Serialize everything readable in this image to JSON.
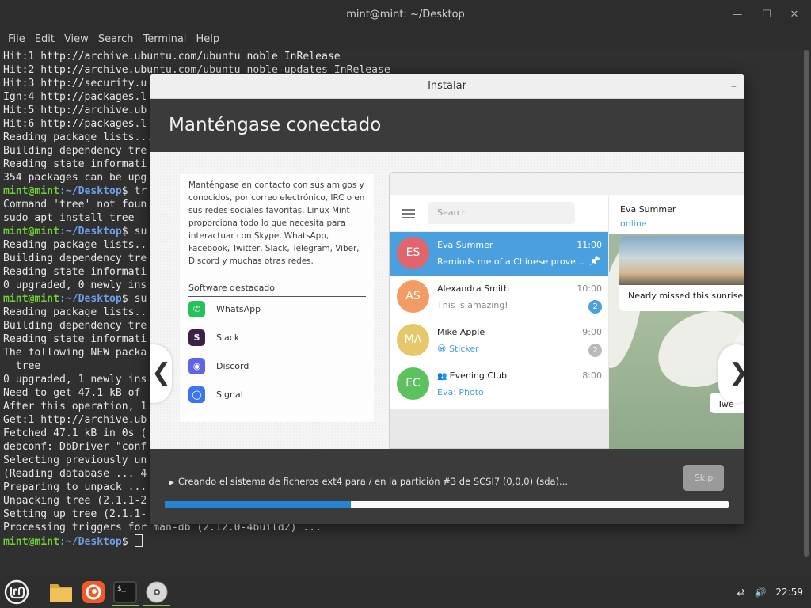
{
  "terminal": {
    "title": "mint@mint: ~/Desktop",
    "menu": [
      "File",
      "Edit",
      "View",
      "Search",
      "Terminal",
      "Help"
    ],
    "lines": [
      {
        "text": "Hit:1 http://archive.ubuntu.com/ubuntu noble InRelease"
      },
      {
        "text": "Hit:2 http://archive.ubuntu.com/ubuntu noble-updates InRelease"
      },
      {
        "text": "Hit:3 http://security.u"
      },
      {
        "text": "Ign:4 http://packages.l"
      },
      {
        "text": "Hit:5 http://archive.ub"
      },
      {
        "text": "Hit:6 http://packages.l"
      },
      {
        "text": "Reading package lists..."
      },
      {
        "text": "Building dependency tre"
      },
      {
        "text": "Reading state informati"
      },
      {
        "text": "354 packages can be upg"
      },
      {
        "prompt": true,
        "text": " tr"
      },
      {
        "text": "Command 'tree' not foun"
      },
      {
        "text": "sudo apt install tree"
      },
      {
        "prompt": true,
        "text": " su"
      },
      {
        "text": "Reading package lists.."
      },
      {
        "text": "Building dependency tre"
      },
      {
        "text": "Reading state informati"
      },
      {
        "text": "0 upgraded, 0 newly ins"
      },
      {
        "prompt": true,
        "text": " su"
      },
      {
        "text": "Reading package lists.."
      },
      {
        "text": "Building dependency tre"
      },
      {
        "text": "Reading state informati"
      },
      {
        "text": "The following NEW packa"
      },
      {
        "text": "  tree"
      },
      {
        "text": "0 upgraded, 1 newly ins"
      },
      {
        "text": "Need to get 47.1 kB of "
      },
      {
        "text": "After this operation, 1"
      },
      {
        "text": "Get:1 http://archive.ub"
      },
      {
        "text": "Fetched 47.1 kB in 0s ("
      },
      {
        "text": "debconf: DbDriver \"conf                                                             oble"
      },
      {
        "text": "Selecting previously un"
      },
      {
        "text": "(Reading database ... 4"
      },
      {
        "text": "Preparing to unpack ..."
      },
      {
        "text": "Unpacking tree (2.1.1-2"
      },
      {
        "text": "Setting up tree (2.1.1-"
      },
      {
        "text": "Processing triggers for man-db (2.12.0-4build2) ..."
      },
      {
        "prompt": true,
        "text": " ",
        "cursor": true
      }
    ],
    "prompt_user": "mint@mint",
    "prompt_path": ":~/Desktop",
    "prompt_sign": "$"
  },
  "installer": {
    "title": "Instalar",
    "minimize": "–",
    "header": "Manténgase conectado",
    "description": "Manténgase en contacto con sus amigos y conocidos, por correo electrónico, IRC o en sus redes sociales favoritas. Linux Mint proporciona todo lo que necesita para interactuar con Skype, WhatsApp, Facebook, Twitter, Slack, Telegram, Viber, Discord y muchas otras redes.",
    "featured_title": "Software destacado",
    "software": [
      {
        "name": "WhatsApp",
        "color": "#25c15a",
        "icon": "whatsapp-icon"
      },
      {
        "name": "Slack",
        "color": "#3e1f48",
        "icon": "slack-icon"
      },
      {
        "name": "Discord",
        "color": "#5b67e8",
        "icon": "discord-icon"
      },
      {
        "name": "Signal",
        "color": "#3a76f0",
        "icon": "signal-icon"
      }
    ],
    "prev": "❮",
    "next": "❯",
    "status": "Creando el sistema de ficheros ext4 para / en la partición #3 de SCSI7 (0,0,0) (sda)...",
    "skip": "Skip",
    "progress": 0.33,
    "accent": "#2585d4"
  },
  "telegram": {
    "search_placeholder": "Search",
    "chats": [
      {
        "initials": "ES",
        "name": "Eva Summer",
        "time": "11:00",
        "msg": "Reminds me of a Chinese proverb...",
        "color": "#e1656c",
        "selected": true,
        "pinned": true
      },
      {
        "initials": "AS",
        "name": "Alexandra Smith",
        "time": "10:00",
        "msg": "This is amazing!",
        "color": "#f29b64",
        "badge": "2",
        "badge_color": "#4a9fde"
      },
      {
        "initials": "MA",
        "name": "Mike Apple",
        "time": "9:00",
        "msg": "😀 Sticker",
        "color": "#e6c86a",
        "badge": "2",
        "badge_color": "#b9b9b9",
        "link": true
      },
      {
        "initials": "EC",
        "name": "Evening Club",
        "time": "8:00",
        "msg": "Eva: Photo",
        "color": "#5cc25f",
        "link": true,
        "group": true
      }
    ],
    "chat_name": "Eva Summer",
    "chat_status": "online",
    "photo_caption": "Nearly missed this sunrise",
    "bubble2": "Twe"
  },
  "taskbar": {
    "clock": "22:59",
    "apps": [
      "mint-menu-icon",
      "files-icon",
      "firefox-icon",
      "terminal-icon",
      "installer-disc-icon"
    ]
  }
}
